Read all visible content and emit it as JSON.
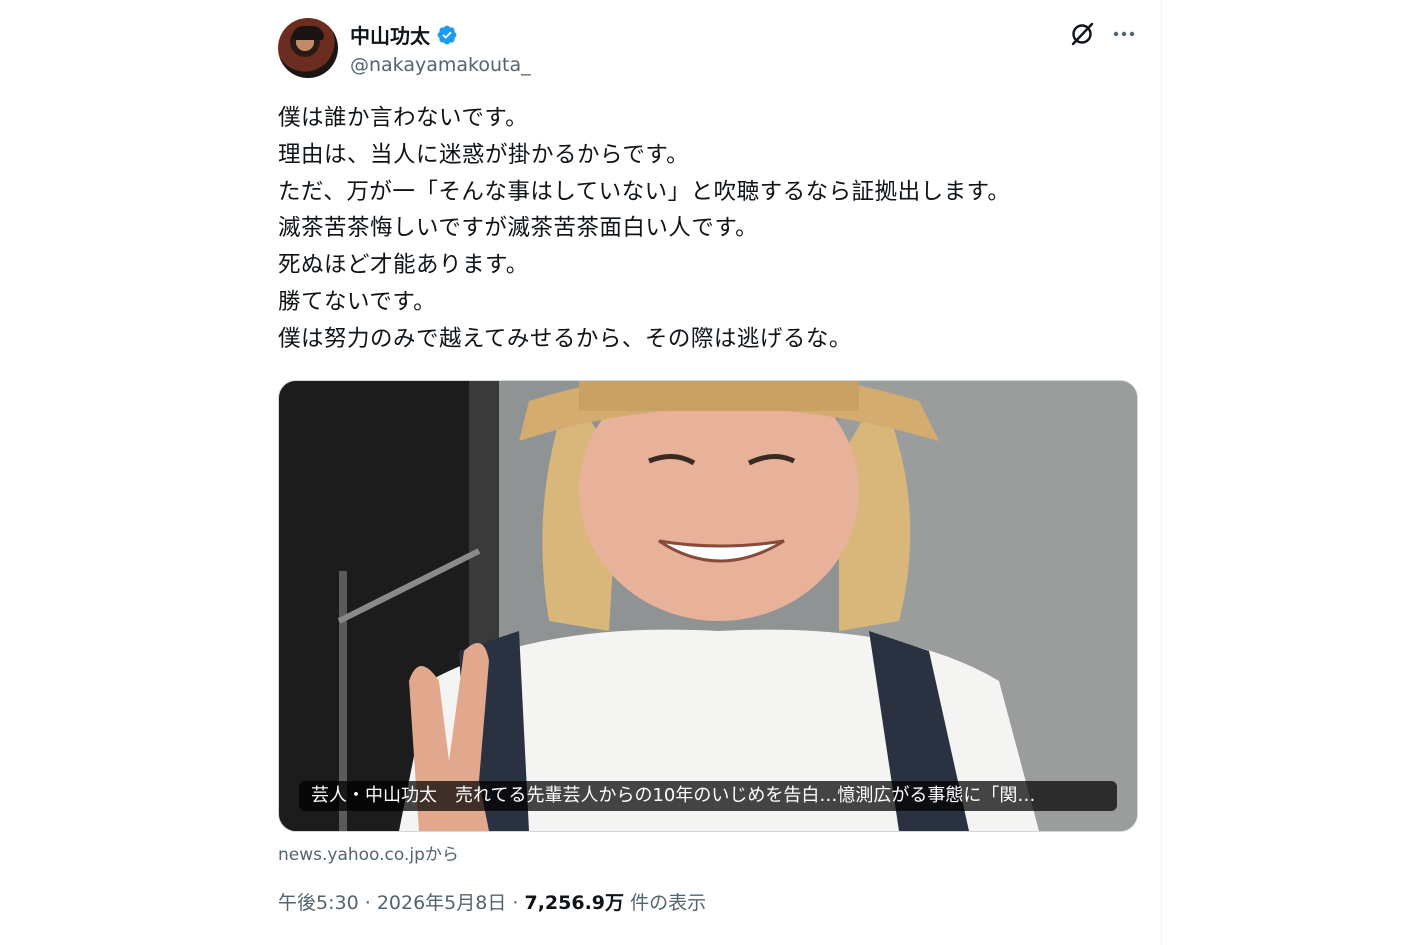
{
  "author": {
    "display_name": "中山功太",
    "handle": "@nakayamakouta_",
    "verified": true
  },
  "header_icons": [
    "grok-icon",
    "more-icon"
  ],
  "tweet": {
    "lines": [
      "僕は誰か言わないです。",
      "理由は、当人に迷惑が掛かるからです。",
      "ただ、万が一「そんな事はしていない」と吹聴するなら証拠出します。",
      "滅茶苦茶悔しいですが滅茶苦茶面白い人です。",
      "死ぬほど才能あります。",
      "勝てないです。",
      "僕は努力のみで越えてみせるから、その際は逃げるな。"
    ]
  },
  "card": {
    "caption": "芸人・中山功太　売れてる先輩芸人からの10年のいじめを告白…憶測広がる事態に「関…",
    "source": "news.yahoo.co.jpから"
  },
  "meta": {
    "time": "午後5:30",
    "separator": "·",
    "date": "2026年5月8日",
    "views_count": "7,256.9万",
    "views_label": "件の表示"
  },
  "colors": {
    "verified": "#1d9bf0",
    "text_primary": "#0f1419",
    "text_secondary": "#536471"
  }
}
